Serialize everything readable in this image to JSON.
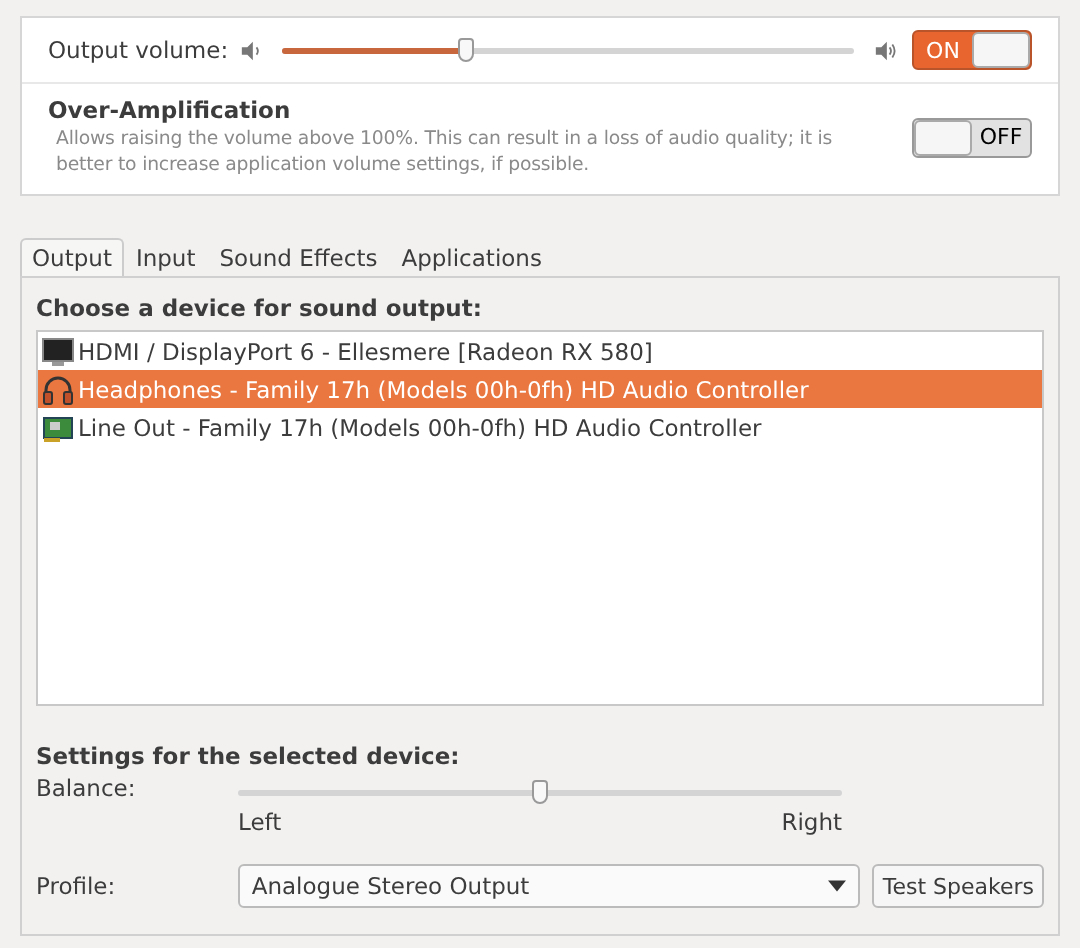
{
  "volume": {
    "label": "Output volume:",
    "level": 0.32,
    "switch": {
      "label": "ON",
      "on": true
    }
  },
  "over_amplification": {
    "title": "Over-Amplification",
    "description": "Allows raising the volume above 100%. This can result in a loss of audio quality; it is better to increase application volume settings, if possible.",
    "switch": {
      "label": "OFF",
      "on": false
    }
  },
  "tabs": [
    {
      "label": "Output",
      "selected": true
    },
    {
      "label": "Input",
      "selected": false
    },
    {
      "label": "Sound Effects",
      "selected": false
    },
    {
      "label": "Applications",
      "selected": false
    }
  ],
  "devices_heading": "Choose a device for sound output:",
  "devices": [
    {
      "kind": "monitor",
      "label": "HDMI / DisplayPort 6 - Ellesmere [Radeon RX 580]",
      "selected": false
    },
    {
      "kind": "headphones",
      "label": "Headphones - Family 17h (Models 00h-0fh) HD Audio Controller",
      "selected": true
    },
    {
      "kind": "card",
      "label": "Line Out - Family 17h (Models 00h-0fh) HD Audio Controller",
      "selected": false
    }
  ],
  "settings_heading": "Settings for the selected device:",
  "balance": {
    "label": "Balance:",
    "level": 0.5,
    "left": "Left",
    "right": "Right"
  },
  "profile": {
    "label": "Profile:",
    "value": "Analogue Stereo Output"
  },
  "test_button": "Test Speakers"
}
